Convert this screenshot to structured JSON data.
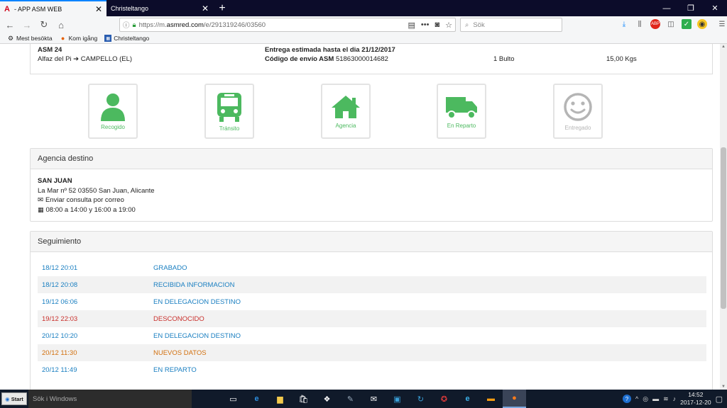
{
  "browser": {
    "tabs": [
      {
        "title": "- APP ASM WEB",
        "active": true
      },
      {
        "title": "Christeltango",
        "active": false
      }
    ],
    "new_tab": "+",
    "url_prefix": "https://m.",
    "url_domain": "asmred.com",
    "url_path": "/e/291319246/03560",
    "search_placeholder": "Sök",
    "bookmarks": [
      "Mest besökta",
      "Kom igång",
      "Christeltango"
    ]
  },
  "shipment": {
    "agency": "ASM 24",
    "route": "Alfaz del Pi ➔ CAMPELLO (EL)",
    "estimate": "Entrega estimada hasta el dia 21/12/2017",
    "code_label": "Código de envío ASM",
    "code": "51863000014682",
    "packages": "1 Bulto",
    "weight": "15,00 Kgs"
  },
  "statuses": [
    {
      "label": "Recogido",
      "icon": "user-icon",
      "state": "done"
    },
    {
      "label": "Tránsito",
      "icon": "bus-icon",
      "state": "done"
    },
    {
      "label": "Agencia",
      "icon": "home-icon",
      "state": "done"
    },
    {
      "label": "En Reparto",
      "icon": "truck-icon",
      "state": "done"
    },
    {
      "label": "Entregado",
      "icon": "smiley-icon",
      "state": "pending"
    }
  ],
  "destination": {
    "heading": "Agencia destino",
    "name": "SAN JUAN",
    "address": "La Mar nº 52 03550 San Juan, Alicante",
    "email_link": "Enviar consulta por correo",
    "hours": "08:00 a 14:00 y 16:00 a 19:00"
  },
  "tracking": {
    "heading": "Seguimiento",
    "rows": [
      {
        "date": "18/12 20:01",
        "status": "GRABADO",
        "color": "#1a7fc1"
      },
      {
        "date": "18/12 20:08",
        "status": "RECIBIDA INFORMACION",
        "color": "#1a7fc1"
      },
      {
        "date": "19/12 06:06",
        "status": "EN DELEGACION DESTINO",
        "color": "#1a7fc1"
      },
      {
        "date": "19/12 22:03",
        "status": "DESCONOCIDO",
        "color": "#c9302c"
      },
      {
        "date": "20/12 10:20",
        "status": "EN DELEGACION DESTINO",
        "color": "#1a7fc1"
      },
      {
        "date": "20/12 11:30",
        "status": "NUEVOS DATOS",
        "color": "#d2700e"
      },
      {
        "date": "20/12 11:49",
        "status": "EN REPARTO",
        "color": "#1a7fc1"
      }
    ]
  },
  "taskbar": {
    "start_label": "Start",
    "search_placeholder": "Sök i Windows",
    "time": "14:52",
    "date": "2017-12-20"
  },
  "colors": {
    "done": "#4cb95f",
    "pending": "#b5b5b5"
  }
}
